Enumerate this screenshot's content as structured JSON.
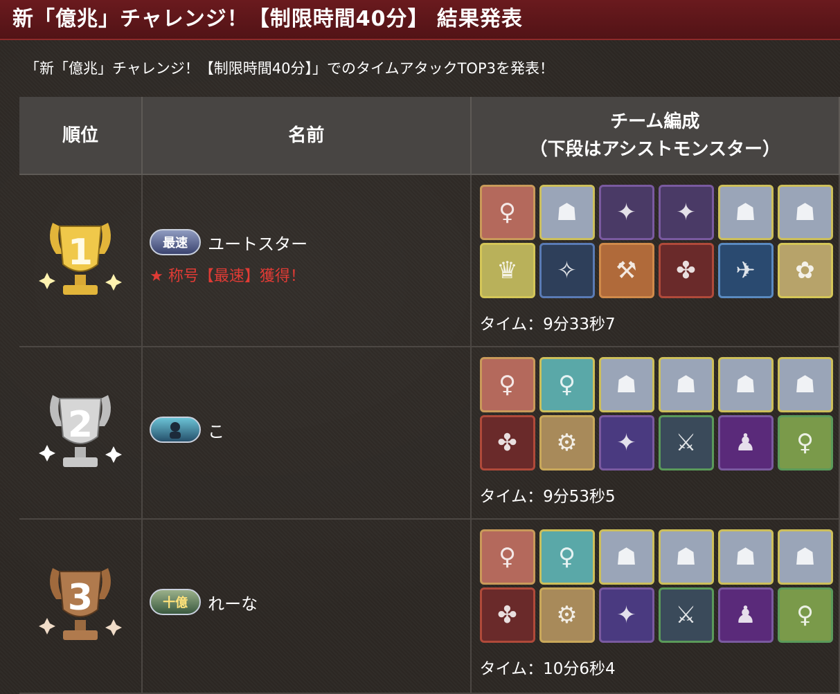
{
  "header": {
    "title": "新「億兆」チャレンジ！【制限時間40分】 結果発表"
  },
  "intro": "「新「億兆」チャレンジ！【制限時間40分】」でのタイムアタックTOP3を発表！",
  "table": {
    "headers": {
      "rank": "順位",
      "name": "名前",
      "team": "チーム編成",
      "team_sub": "（下段はアシストモンスター）"
    },
    "rows": [
      {
        "rank": "1",
        "badge": "最速",
        "name": "ユートスター",
        "title_gain": "★ 称号【最速】獲得！",
        "time": "タイム：9分33秒7",
        "team": [
          "♀",
          "☗",
          "✦",
          "✦",
          "☗",
          "☗"
        ],
        "assist": [
          "♛",
          "✧",
          "⚒",
          "✤",
          "✈",
          "✿"
        ]
      },
      {
        "rank": "2",
        "badge": "",
        "name": "こ",
        "title_gain": "",
        "time": "タイム：9分53秒5",
        "team": [
          "♀",
          "♀",
          "☗",
          "☗",
          "☗",
          "☗"
        ],
        "assist": [
          "✤",
          "⚙",
          "✦",
          "⚔",
          "♟",
          "♀"
        ]
      },
      {
        "rank": "3",
        "badge": "十億",
        "name": "れーな",
        "title_gain": "",
        "time": "タイム：10分6秒4",
        "team": [
          "♀",
          "♀",
          "☗",
          "☗",
          "☗",
          "☗"
        ],
        "assist": [
          "✤",
          "⚙",
          "✦",
          "⚔",
          "♟",
          "♀"
        ]
      }
    ]
  },
  "colors": {
    "gold": "#e2b53a",
    "silver": "#c8c8c8",
    "bronze": "#b07a4d",
    "accent": "#e03b35",
    "header": "#5c1619"
  }
}
